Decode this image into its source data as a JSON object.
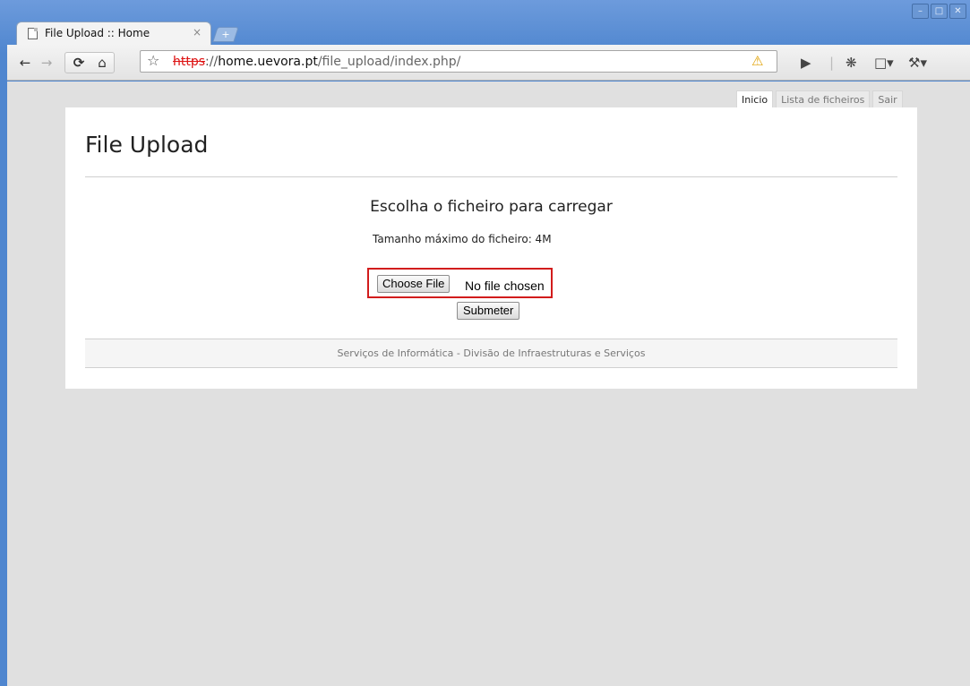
{
  "browser": {
    "tab_title": "File Upload :: Home",
    "tab_close": "×",
    "new_tab": "+",
    "url_scheme": "https",
    "url_sep": "://",
    "url_host": "home.uevora.pt",
    "url_path": "/file_upload/index.php/",
    "window_buttons": [
      "–",
      "□",
      "✕"
    ]
  },
  "nav": {
    "tabs": [
      "Inicio",
      "Lista de ficheiros",
      "Sair"
    ],
    "active": "Inicio"
  },
  "page": {
    "title": "File Upload",
    "heading": "Escolha o ficheiro para carregar",
    "max_size": "Tamanho máximo do ficheiro: 4M",
    "choose_button": "Choose File",
    "no_file": "No file chosen",
    "submit_button": "Submeter",
    "footer": "Serviços de Informática - Divisão de Infraestruturas e Serviços"
  },
  "colors": {
    "highlight_box": "#d21c1c",
    "url_scheme": "#dd1111"
  }
}
